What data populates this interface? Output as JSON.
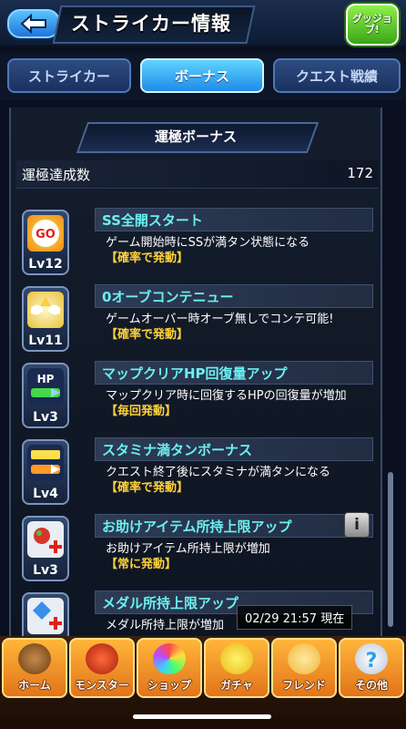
{
  "header": {
    "title": "ストライカー情報",
    "good_job": "グッジョブ!"
  },
  "tabs": [
    {
      "label": "ストライカー",
      "active": false
    },
    {
      "label": "ボーナス",
      "active": true
    },
    {
      "label": "クエスト戦績",
      "active": false
    }
  ],
  "panel": {
    "title": "運極ボーナス",
    "count_label": "運極達成数",
    "count_value": "172"
  },
  "bonuses": [
    {
      "icon": "go-badge-icon",
      "level": "Lv12",
      "name": "SS全開スタート",
      "desc": "ゲーム開始時にSSが満タン状態になる",
      "trigger": "【確率で発動】"
    },
    {
      "icon": "winged-orb-icon",
      "level": "Lv11",
      "name": "0オーブコンテニュー",
      "desc": "ゲームオーバー時オーブ無しでコンテ可能!",
      "trigger": "【確率で発動】"
    },
    {
      "icon": "hp-gauge-icon",
      "level": "Lv3",
      "name": "マップクリアHP回復量アップ",
      "desc": "マップクリア時に回復するHPの回復量が増加",
      "trigger": "【毎回発動】"
    },
    {
      "icon": "stamina-gauge-icon",
      "level": "Lv4",
      "name": "スタミナ満タンボーナス",
      "desc": "クエスト終了後にスタミナが満タンになる",
      "trigger": "【確率で発動】"
    },
    {
      "icon": "help-item-plus-icon",
      "level": "Lv3",
      "name": "お助けアイテム所持上限アップ",
      "desc": "お助けアイテム所持上限が増加",
      "trigger": "【常に発動】",
      "info": "i"
    },
    {
      "icon": "medal-plus-icon",
      "level": "",
      "name": "メダル所持上限アップ",
      "desc": "メダル所持上限が増加",
      "trigger": ""
    }
  ],
  "timestamp": "02/29 21:57 現在",
  "nav": [
    {
      "label": "ホーム",
      "icon": "home-icon"
    },
    {
      "label": "モンスター",
      "icon": "monster-icon"
    },
    {
      "label": "ショップ",
      "icon": "shop-orb-icon"
    },
    {
      "label": "ガチャ",
      "icon": "gacha-icon"
    },
    {
      "label": "フレンド",
      "icon": "friend-icon"
    },
    {
      "label": "その他",
      "icon": "other-icon"
    }
  ],
  "colors": {
    "name_text": "#6af0f0",
    "trigger_text": "#ffd23a",
    "tab_active": "#1f8be8",
    "nav_button": "#ffb63a"
  }
}
